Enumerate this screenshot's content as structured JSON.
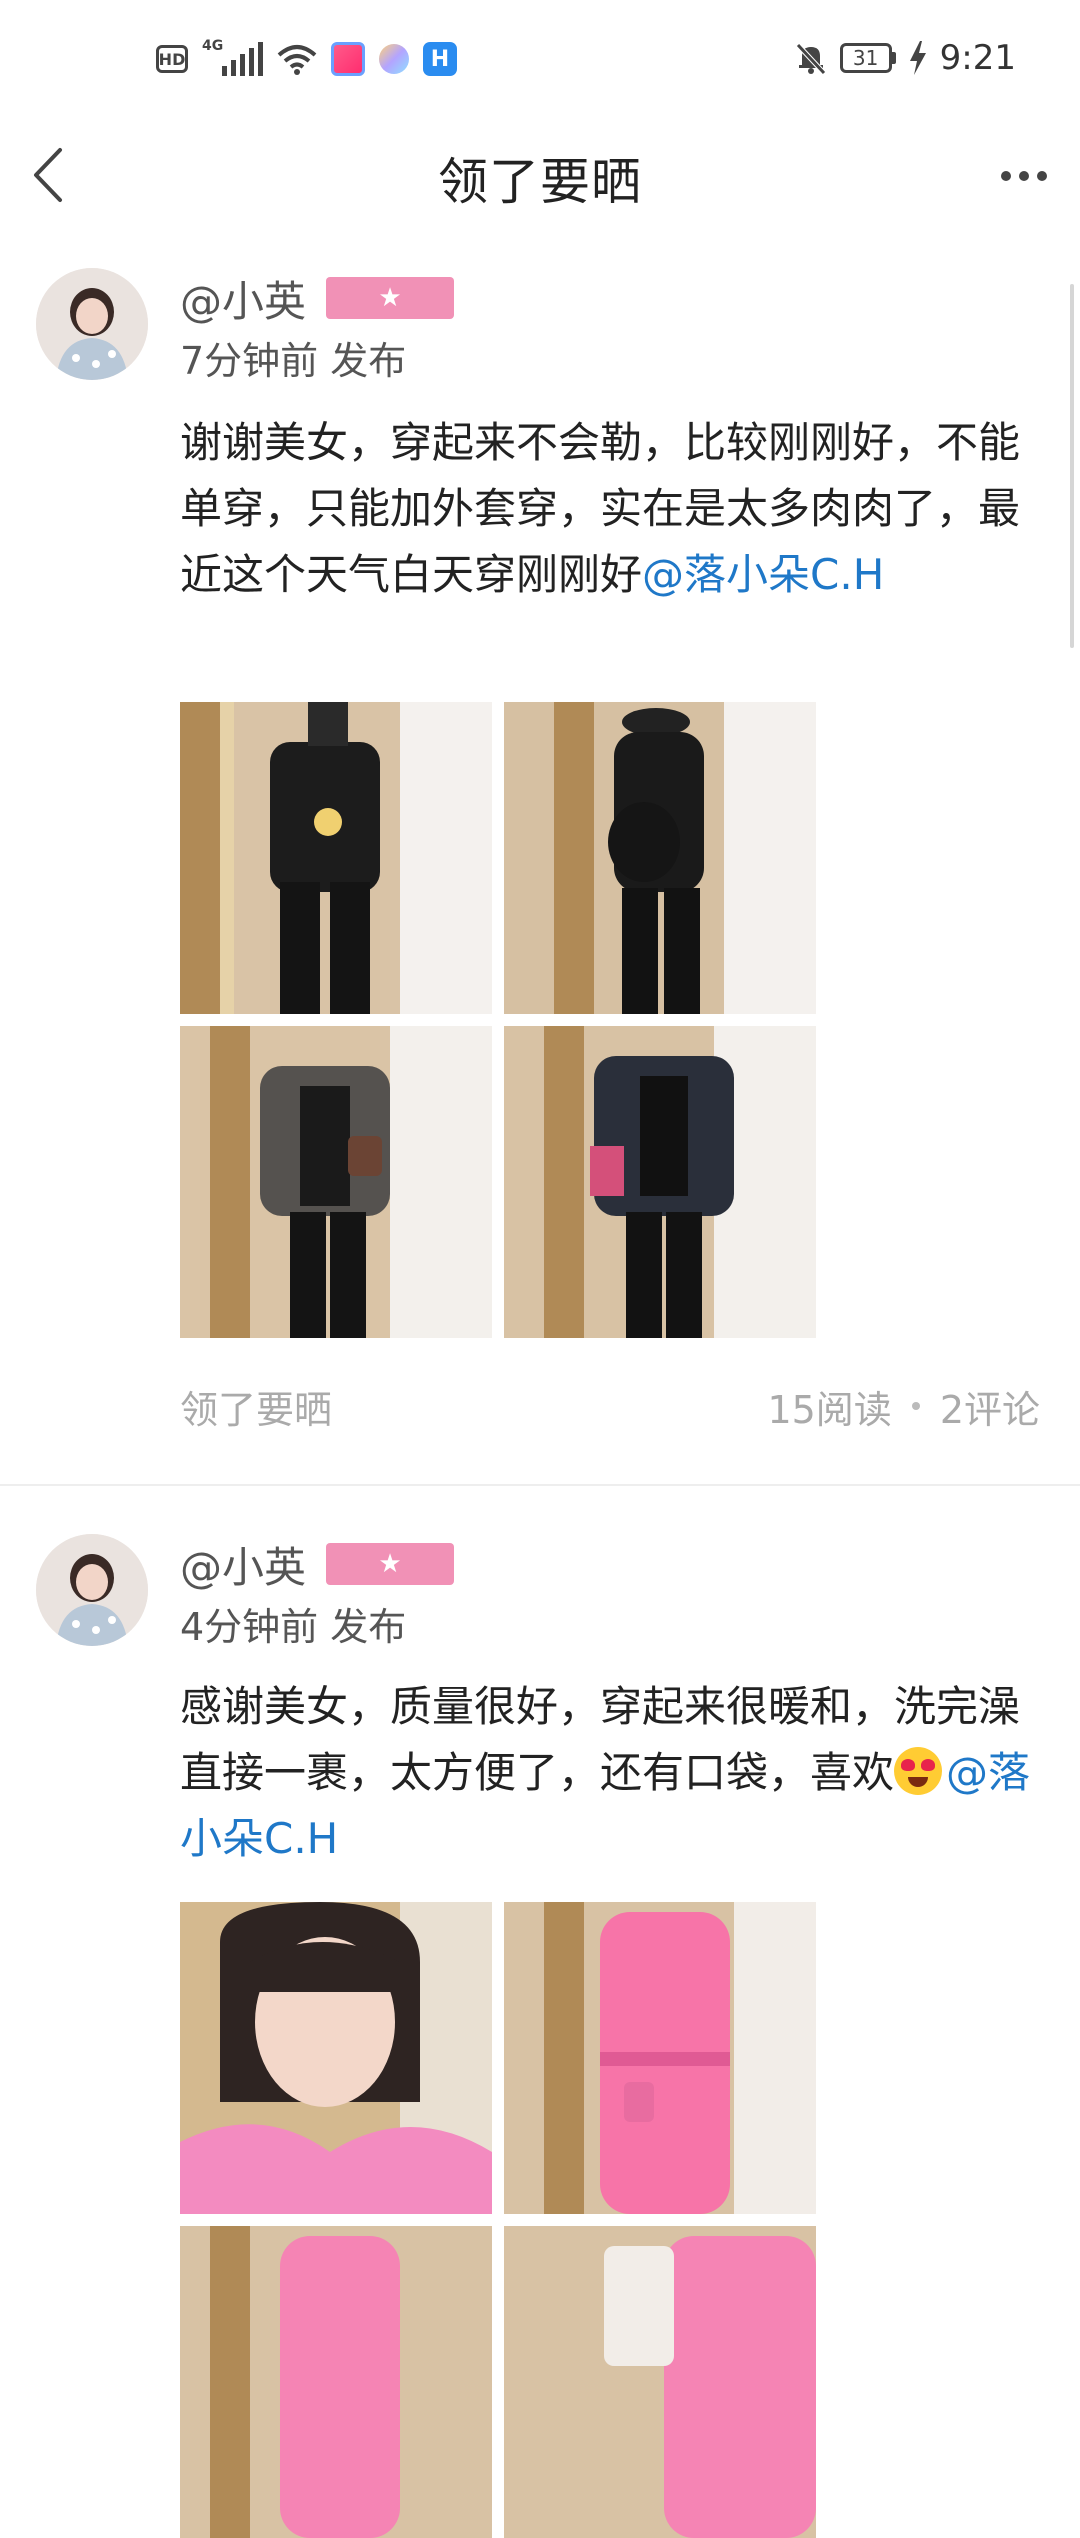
{
  "status_bar": {
    "hd_label": "HD",
    "network_label": "4G",
    "battery_level": "31",
    "time": "9:21"
  },
  "header": {
    "title": "领了要晒"
  },
  "posts": [
    {
      "username": "@小英",
      "badge": "★",
      "time": "7分钟前 发布",
      "text": "谢谢美女，穿起来不会勒，比较刚刚好，不能单穿，只能加外套穿，实在是太多肉肉了，最近这个天气白天穿刚刚好",
      "mention": "@落小朵C.H",
      "topic": "领了要晒",
      "reads": "15阅读",
      "comments": "2评论"
    },
    {
      "username": "@小英",
      "badge": "★",
      "time": "4分钟前 发布",
      "text": "感谢美女，质量很好，穿起来很暖和，洗完澡直接一裹，太方便了，还有口袋，喜欢",
      "mention": "@落小朵C.H"
    }
  ],
  "colors": {
    "badge": "#f191b6",
    "mention": "#1f78c8",
    "muted": "#aaaaaa"
  }
}
